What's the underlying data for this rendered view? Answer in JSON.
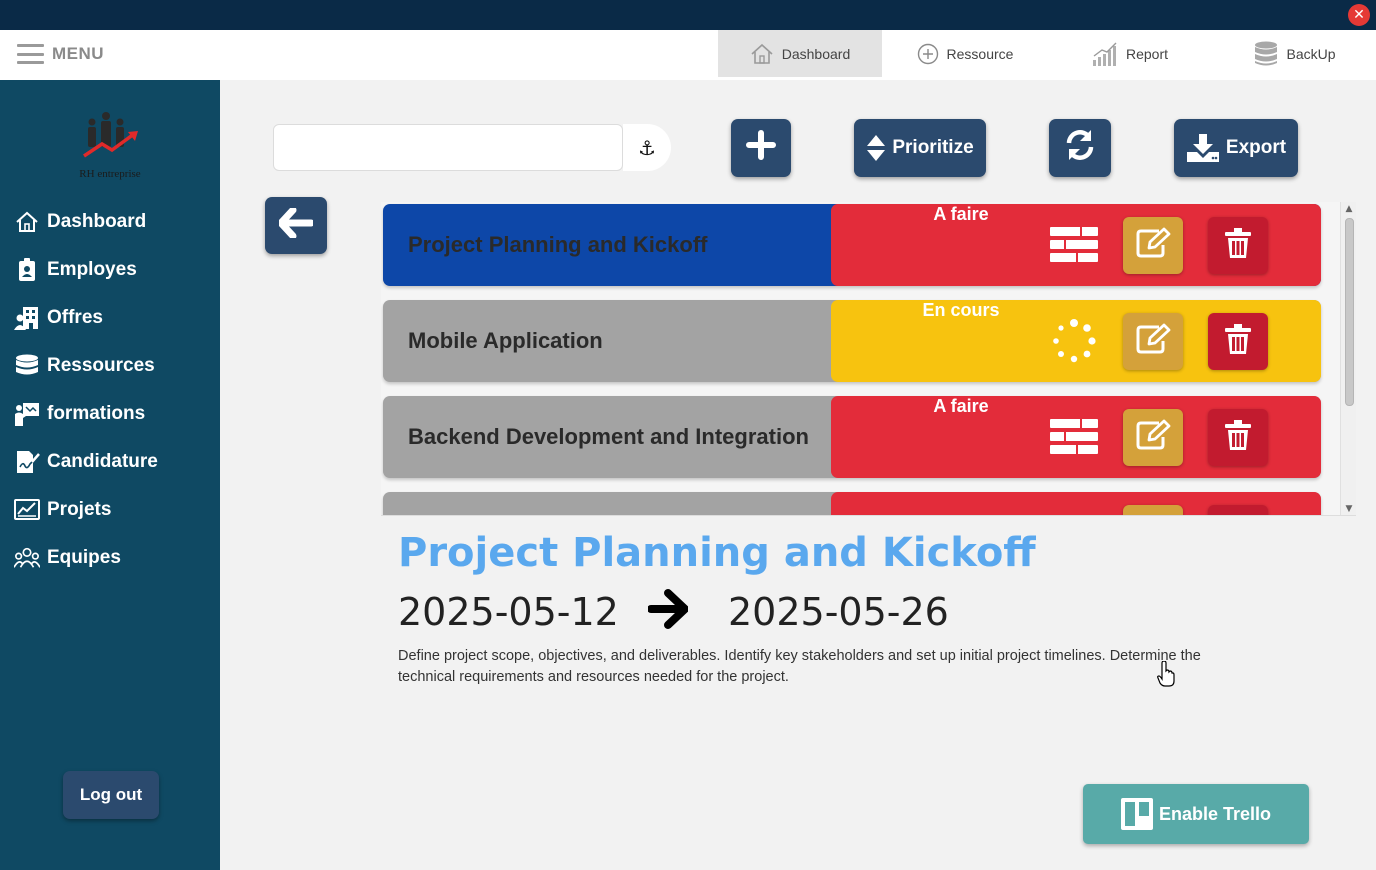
{
  "window": {
    "close_icon": "close-icon",
    "close_glyph": "✕"
  },
  "menu": {
    "label": "MENU"
  },
  "top_tabs": [
    {
      "label": "Dashboard",
      "icon": "home-icon",
      "active": true
    },
    {
      "label": "Ressource",
      "icon": "plus-circle-icon",
      "active": false
    },
    {
      "label": "Report",
      "icon": "signal-bars-icon",
      "active": false
    },
    {
      "label": "BackUp",
      "icon": "database-icon",
      "active": false
    }
  ],
  "brand": {
    "logo_text": "RH entreprise"
  },
  "sidebar": {
    "items": [
      {
        "label": "Dashboard",
        "icon": "home-icon"
      },
      {
        "label": "Employes",
        "icon": "id-badge-icon"
      },
      {
        "label": "Offres",
        "icon": "building-user-icon"
      },
      {
        "label": "Ressources",
        "icon": "database-icon"
      },
      {
        "label": "formations",
        "icon": "presentation-icon"
      },
      {
        "label": "Candidature",
        "icon": "signature-icon"
      },
      {
        "label": "Projets",
        "icon": "chart-board-icon"
      },
      {
        "label": "Equipes",
        "icon": "team-icon"
      }
    ],
    "logout_label": "Log out"
  },
  "toolbar": {
    "search_value": "",
    "anchor_icon": "anchor-icon",
    "anchor_glyph": "⚓",
    "add_icon": "plus-icon",
    "prioritize_label": "Prioritize",
    "refresh_icon": "refresh-icon",
    "export_label": "Export",
    "back_icon": "arrow-left-icon"
  },
  "colors": {
    "sidebar_bg": "#0f4963",
    "button_bg": "#2b4a6e",
    "title_blue": "#5aa8ee",
    "status_todo": "#e32c3a",
    "status_inprogress": "#f7c30f",
    "row_selected": "#0d47a8",
    "row_default": "#a3a3a3",
    "edit_btn": "#d4a13a",
    "delete_btn": "#c21b2f",
    "trello_btn": "#58aaa8"
  },
  "tasks": [
    {
      "name": "Project Planning and Kickoff",
      "status": "A faire",
      "status_icon": "list-icon",
      "selected": true
    },
    {
      "name": "Mobile Application",
      "status": "En cours",
      "status_icon": "spinner-icon",
      "selected": false
    },
    {
      "name": "Backend Development and Integration",
      "status": "A faire",
      "status_icon": "list-icon",
      "selected": false
    }
  ],
  "detail": {
    "title": "Project Planning and Kickoff",
    "start_date": "2025-05-12",
    "end_date": "2025-05-26",
    "description": "Define project scope, objectives, and deliverables. Identify key stakeholders and set up initial project timelines. Determine the technical requirements and resources needed for the project."
  },
  "trello": {
    "label": "Enable Trello"
  }
}
